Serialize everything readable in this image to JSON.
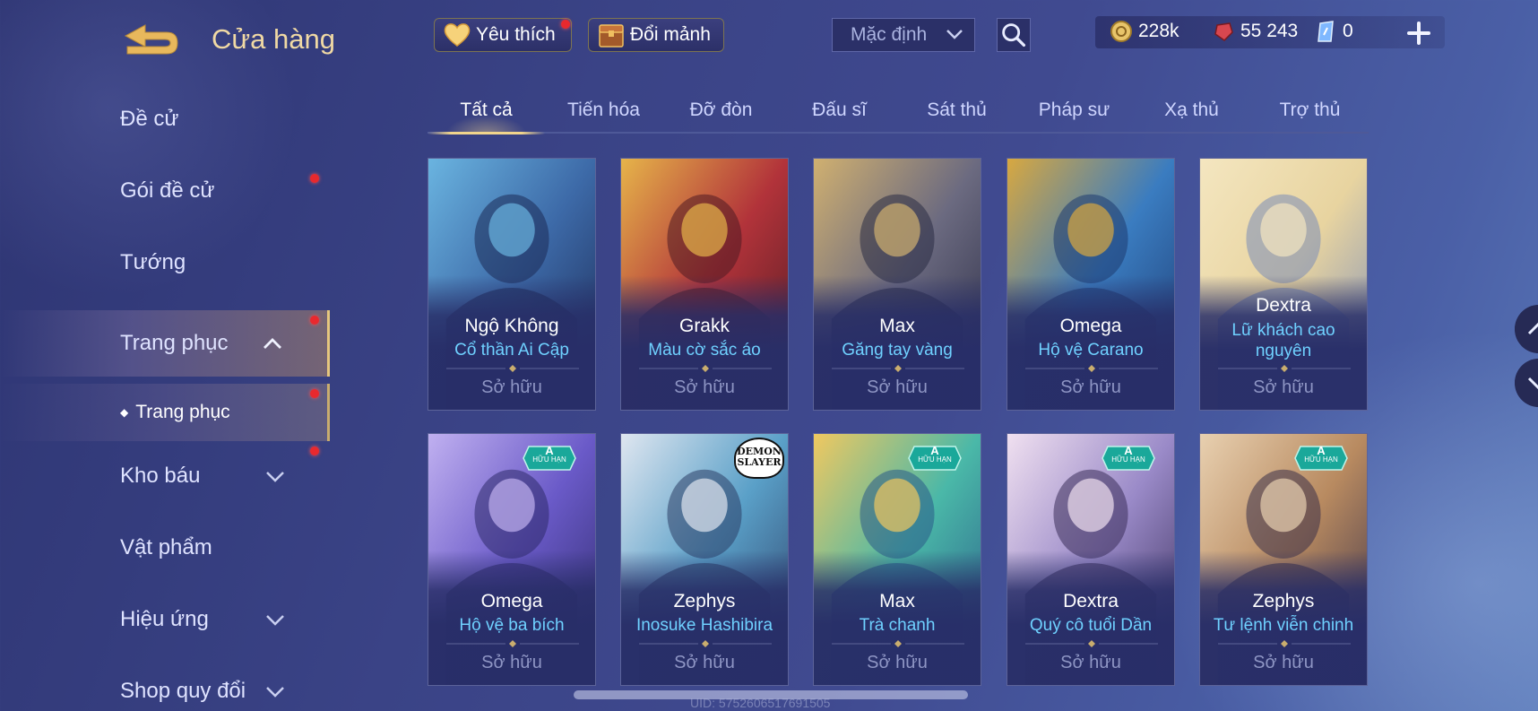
{
  "header": {
    "title": "Cửa hàng",
    "favorites_label": "Yêu thích",
    "exchange_label": "Đổi mảnh",
    "sort_value": "Mặc định"
  },
  "currency": {
    "gold": "228k",
    "gems": "55 243",
    "vouchers": "0"
  },
  "sidebar": {
    "items": [
      {
        "label": "Đề cử"
      },
      {
        "label": "Gói đề cử"
      },
      {
        "label": "Tướng"
      },
      {
        "label": "Trang phục"
      },
      {
        "label": "Trang phục"
      },
      {
        "label": "Kho báu"
      },
      {
        "label": "Vật phẩm"
      },
      {
        "label": "Hiệu ứng"
      },
      {
        "label": "Shop quy đổi"
      }
    ]
  },
  "tabs": [
    {
      "label": "Tất cả"
    },
    {
      "label": "Tiến hóa"
    },
    {
      "label": "Đỡ đòn"
    },
    {
      "label": "Đấu sĩ"
    },
    {
      "label": "Sát thủ"
    },
    {
      "label": "Pháp sư"
    },
    {
      "label": "Xạ thủ"
    },
    {
      "label": "Trợ thủ"
    }
  ],
  "cards": [
    {
      "hero": "Ngộ Không",
      "skin": "Cổ thần Ai Cập",
      "status": "Sở hữu"
    },
    {
      "hero": "Grakk",
      "skin": "Màu cờ sắc áo",
      "status": "Sở hữu"
    },
    {
      "hero": "Max",
      "skin": "Găng tay vàng",
      "status": "Sở hữu"
    },
    {
      "hero": "Omega",
      "skin": "Hộ vệ Carano",
      "status": "Sở hữu"
    },
    {
      "hero": "Dextra",
      "skin": "Lữ khách cao nguyên",
      "status": "Sở hữu"
    },
    {
      "hero": "Omega",
      "skin": "Hộ vệ ba bích",
      "status": "Sở hữu"
    },
    {
      "hero": "Zephys",
      "skin": "Inosuke Hashibira",
      "status": "Sở hữu"
    },
    {
      "hero": "Max",
      "skin": "Trà chanh",
      "status": "Sở hữu"
    },
    {
      "hero": "Dextra",
      "skin": "Quý cô tuổi Dần",
      "status": "Sở hữu"
    },
    {
      "hero": "Zephys",
      "skin": "Tư lệnh viễn chinh",
      "status": "Sở hữu"
    }
  ],
  "badge": {
    "grade": "A",
    "label": "HỮU HẠN"
  },
  "collab_logo": "DEMON SLAYER",
  "uid": "UID: 5752606517691505",
  "colors": {
    "accent_gold": "#f1d58c",
    "skin_name": "#6fd1ff",
    "notification": "#e8292e",
    "owned_text": "#8e95c4"
  }
}
